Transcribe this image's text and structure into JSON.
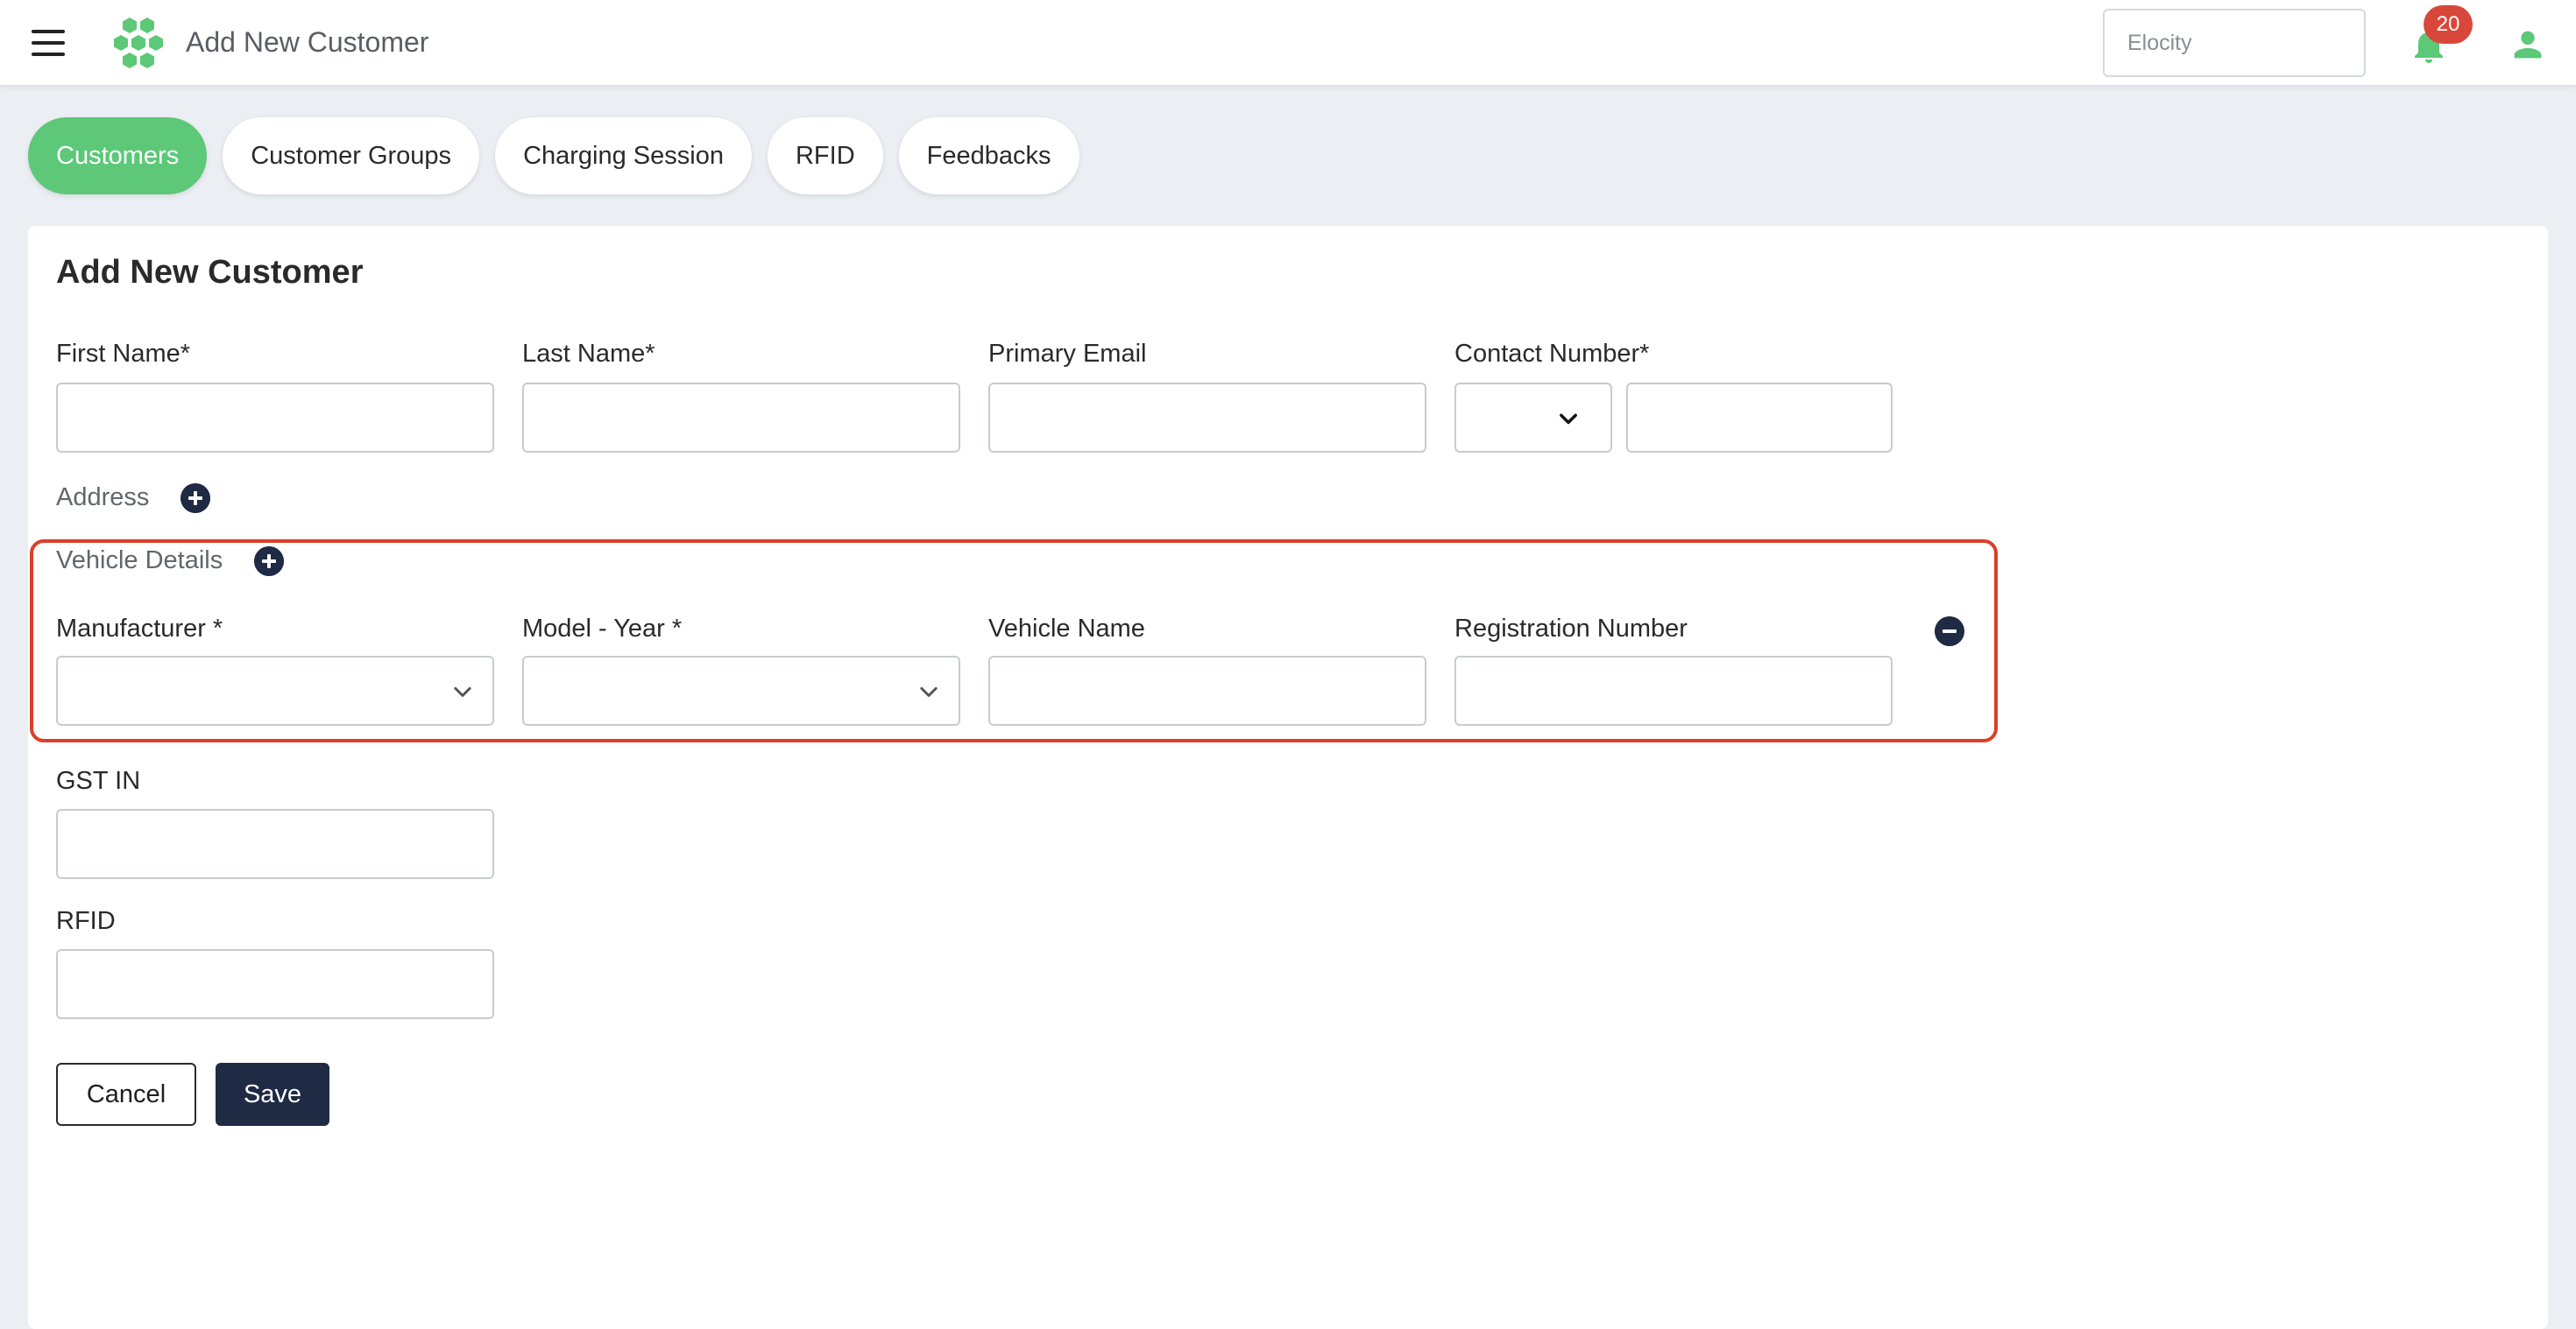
{
  "header": {
    "title": "Add New Customer",
    "org_select_value": "Elocity",
    "notification_count": "20",
    "brand_color": "#5cc878"
  },
  "tabs": [
    {
      "label": "Customers",
      "active": true
    },
    {
      "label": "Customer Groups",
      "active": false
    },
    {
      "label": "Charging Session",
      "active": false
    },
    {
      "label": "RFID",
      "active": false
    },
    {
      "label": "Feedbacks",
      "active": false
    }
  ],
  "form": {
    "title": "Add New Customer",
    "first_name_label": "First Name*",
    "last_name_label": "Last Name*",
    "primary_email_label": "Primary Email",
    "contact_number_label": "Contact Number*",
    "address_label": "Address",
    "vehicle_details_label": "Vehicle Details",
    "manufacturer_label": "Manufacturer *",
    "model_year_label": "Model - Year *",
    "vehicle_name_label": "Vehicle Name",
    "registration_number_label": "Registration Number",
    "gst_label": "GST IN",
    "rfid_label": "RFID",
    "first_name_value": "",
    "last_name_value": "",
    "primary_email_value": "",
    "contact_number_value": "",
    "vehicle_name_value": "",
    "registration_number_value": "",
    "gst_value": "",
    "rfid_value": ""
  },
  "actions": {
    "cancel_label": "Cancel",
    "save_label": "Save"
  },
  "colors": {
    "accent_green": "#5cc878",
    "dark_navy": "#1f2a44",
    "highlight_red": "#db3f2a",
    "badge_red": "#d9473b"
  },
  "icons": [
    "menu-icon",
    "logo-icon",
    "bell-icon",
    "user-icon",
    "plus-circle-icon",
    "minus-circle-icon",
    "chevron-down-icon"
  ]
}
